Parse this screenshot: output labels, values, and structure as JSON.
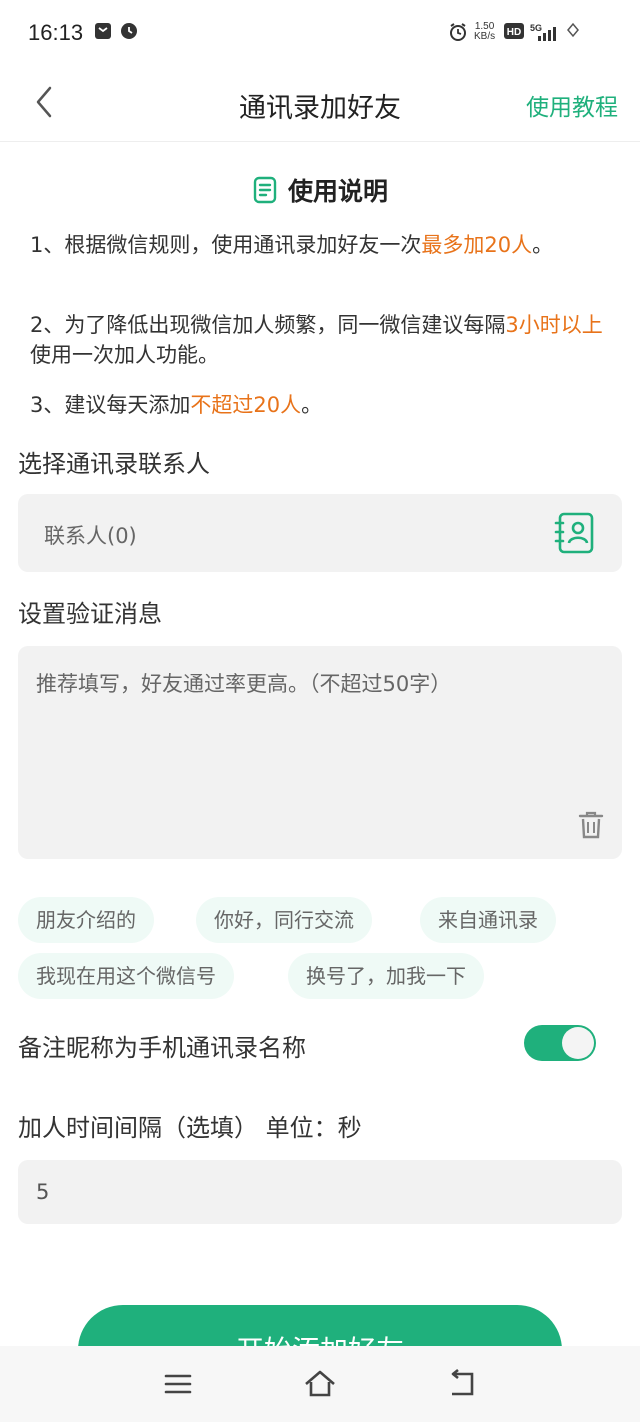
{
  "status_bar": {
    "time": "16:13",
    "speed_value": "1.50",
    "speed_unit": "KB/s",
    "icons": [
      "notification-icon",
      "app-badge-icon",
      "alarm-icon",
      "hd-icon",
      "5g-signal-icon",
      "battery-icon"
    ]
  },
  "header": {
    "title": "通讯录加好友",
    "tutorial": "使用教程"
  },
  "instructions": {
    "heading": "使用说明",
    "rule1_pre": "1、根据微信规则，使用通讯录加好友一次",
    "rule1_hl": "最多加20人",
    "rule1_post": "。",
    "rule2_pre": "2、为了降低出现微信加人频繁，同一微信建议每隔",
    "rule2_hl": "3小时以上",
    "rule2_post": "使用一次加人功能。",
    "rule3_pre": "3、建议每天添加",
    "rule3_hl": "不超过20人",
    "rule3_post": "。"
  },
  "contacts": {
    "label": "选择通讯录联系人",
    "value": "联系人(0)"
  },
  "verify": {
    "label": "设置验证消息",
    "placeholder": "推荐填写，好友通过率更高。（不超过50字）"
  },
  "quick_tags": [
    "朋友介绍的",
    "你好，同行交流",
    "来自通讯录",
    "我现在用这个微信号",
    "换号了，加我一下"
  ],
  "remark": {
    "label": "备注昵称为手机通讯录名称",
    "enabled": true
  },
  "interval": {
    "label": "加人时间间隔（选填） 单位：秒",
    "value": "5"
  },
  "start_button": "开始添加好友",
  "colors": {
    "accent": "#1fb07c",
    "highlight": "#e8731a",
    "field_bg": "#f2f2f2"
  }
}
